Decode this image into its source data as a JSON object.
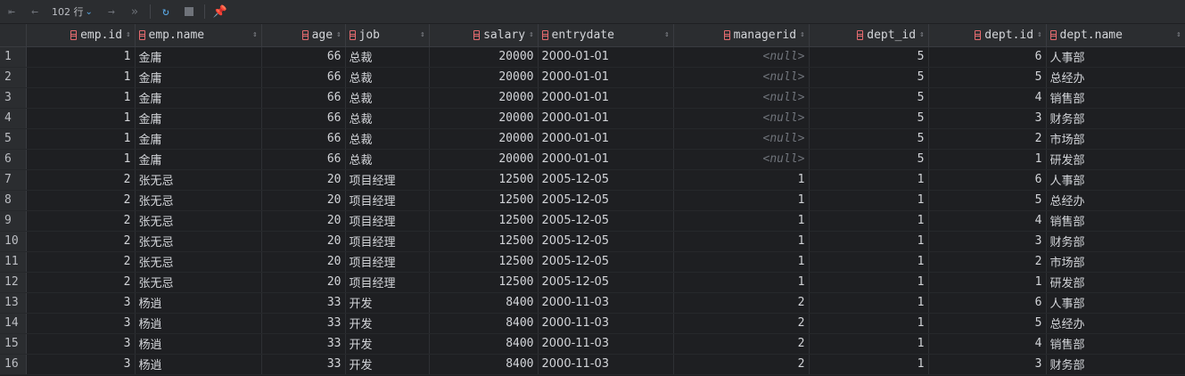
{
  "toolbar": {
    "row_count": "102 行",
    "icons": [
      "first-page-icon",
      "prev-page-icon",
      "chevron-down-icon",
      "next-page-icon",
      "last-page-icon",
      "refresh-icon",
      "stop-icon",
      "pin-icon"
    ]
  },
  "columns": [
    {
      "name": "emp.id",
      "align": "right"
    },
    {
      "name": "emp.name",
      "align": "left"
    },
    {
      "name": "age",
      "align": "right"
    },
    {
      "name": "job",
      "align": "left"
    },
    {
      "name": "salary",
      "align": "right"
    },
    {
      "name": "entrydate",
      "align": "left"
    },
    {
      "name": "managerid",
      "align": "right"
    },
    {
      "name": "dept_id",
      "align": "right"
    },
    {
      "name": "dept.id",
      "align": "right"
    },
    {
      "name": "dept.name",
      "align": "left"
    }
  ],
  "null_text": "<null>",
  "rows": [
    [
      "1",
      "1",
      "金庸",
      "66",
      "总裁",
      "20000",
      "2000-01-01",
      null,
      "5",
      "6",
      "人事部"
    ],
    [
      "2",
      "1",
      "金庸",
      "66",
      "总裁",
      "20000",
      "2000-01-01",
      null,
      "5",
      "5",
      "总经办"
    ],
    [
      "3",
      "1",
      "金庸",
      "66",
      "总裁",
      "20000",
      "2000-01-01",
      null,
      "5",
      "4",
      "销售部"
    ],
    [
      "4",
      "1",
      "金庸",
      "66",
      "总裁",
      "20000",
      "2000-01-01",
      null,
      "5",
      "3",
      "财务部"
    ],
    [
      "5",
      "1",
      "金庸",
      "66",
      "总裁",
      "20000",
      "2000-01-01",
      null,
      "5",
      "2",
      "市场部"
    ],
    [
      "6",
      "1",
      "金庸",
      "66",
      "总裁",
      "20000",
      "2000-01-01",
      null,
      "5",
      "1",
      "研发部"
    ],
    [
      "7",
      "2",
      "张无忌",
      "20",
      "项目经理",
      "12500",
      "2005-12-05",
      "1",
      "1",
      "6",
      "人事部"
    ],
    [
      "8",
      "2",
      "张无忌",
      "20",
      "项目经理",
      "12500",
      "2005-12-05",
      "1",
      "1",
      "5",
      "总经办"
    ],
    [
      "9",
      "2",
      "张无忌",
      "20",
      "项目经理",
      "12500",
      "2005-12-05",
      "1",
      "1",
      "4",
      "销售部"
    ],
    [
      "10",
      "2",
      "张无忌",
      "20",
      "项目经理",
      "12500",
      "2005-12-05",
      "1",
      "1",
      "3",
      "财务部"
    ],
    [
      "11",
      "2",
      "张无忌",
      "20",
      "项目经理",
      "12500",
      "2005-12-05",
      "1",
      "1",
      "2",
      "市场部"
    ],
    [
      "12",
      "2",
      "张无忌",
      "20",
      "项目经理",
      "12500",
      "2005-12-05",
      "1",
      "1",
      "1",
      "研发部"
    ],
    [
      "13",
      "3",
      "杨逍",
      "33",
      "开发",
      "8400",
      "2000-11-03",
      "2",
      "1",
      "6",
      "人事部"
    ],
    [
      "14",
      "3",
      "杨逍",
      "33",
      "开发",
      "8400",
      "2000-11-03",
      "2",
      "1",
      "5",
      "总经办"
    ],
    [
      "15",
      "3",
      "杨逍",
      "33",
      "开发",
      "8400",
      "2000-11-03",
      "2",
      "1",
      "4",
      "销售部"
    ],
    [
      "16",
      "3",
      "杨逍",
      "33",
      "开发",
      "8400",
      "2000-11-03",
      "2",
      "1",
      "3",
      "财务部"
    ]
  ]
}
